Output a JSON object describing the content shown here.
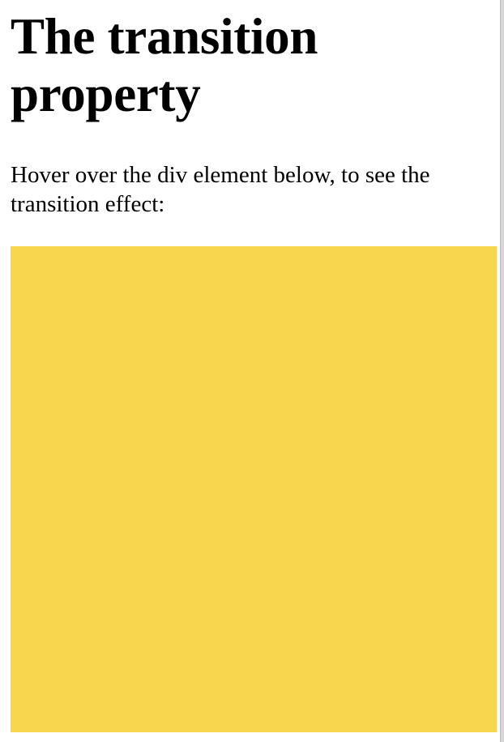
{
  "page": {
    "heading": "The transition property",
    "instruction": "Hover over the div element below, to see the transition effect:"
  },
  "demo_box": {
    "color": "#f8d64e"
  },
  "colors": {
    "background": "#ffffff",
    "text": "#000000",
    "scrollbar": "#d7d7d7"
  }
}
